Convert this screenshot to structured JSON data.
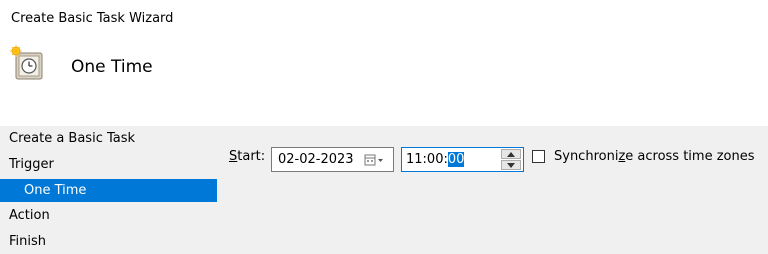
{
  "window": {
    "title": "Create Basic Task Wizard"
  },
  "header": {
    "heading": "One Time",
    "icon": "clock-icon"
  },
  "nav": {
    "items": [
      {
        "label": "Create a Basic Task",
        "selected": false,
        "sub": false
      },
      {
        "label": "Trigger",
        "selected": false,
        "sub": false
      },
      {
        "label": "One Time",
        "selected": true,
        "sub": true
      },
      {
        "label": "Action",
        "selected": false,
        "sub": false
      },
      {
        "label": "Finish",
        "selected": false,
        "sub": false
      }
    ]
  },
  "form": {
    "start_label_accel": "S",
    "start_label_rest": "tart:",
    "date_value": "02-02-2023",
    "time_prefix": "11:00:",
    "time_selected": "00",
    "sync_checked": false,
    "sync_label_a": "Synchroni",
    "sync_label_accel": "z",
    "sync_label_b": "e across time zones"
  },
  "colors": {
    "accent": "#0078d7",
    "panel": "#f0f0f0"
  }
}
